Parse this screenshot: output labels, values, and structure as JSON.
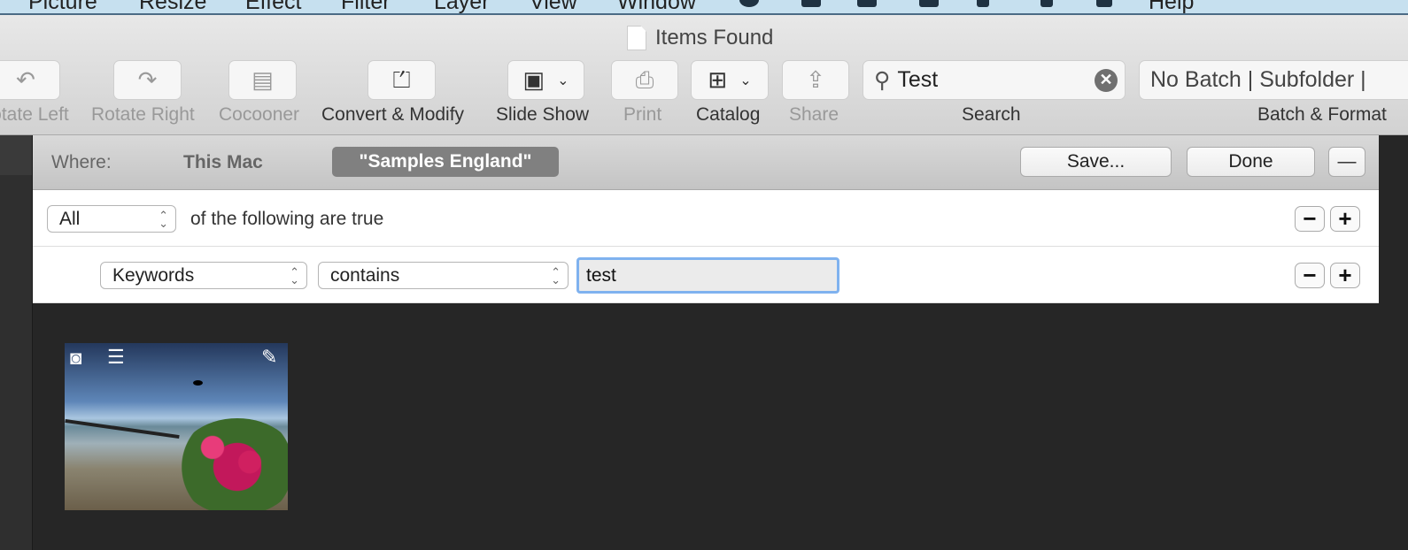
{
  "menu": [
    "Picture",
    "Resize",
    "Effect",
    "Filter",
    "Layer",
    "View",
    "Window",
    "Help"
  ],
  "window": {
    "title": "Items Found"
  },
  "toolbar": {
    "rotate_left": "Rotate Left",
    "rotate_right": "Rotate Right",
    "cocooner": "Cocooner",
    "convert": "Convert & Modify",
    "slideshow": "Slide Show",
    "print": "Print",
    "catalog": "Catalog",
    "share": "Share",
    "search_label": "Search",
    "search_value": "Test",
    "batch_value": "No Batch | Subfolder | ",
    "batch_label": "Batch & Format"
  },
  "where": {
    "label": "Where:",
    "this_mac": "This Mac",
    "scope": "\"Samples England\"",
    "save": "Save...",
    "done": "Done",
    "minus": "—"
  },
  "criteria": {
    "match": "All",
    "following": "of the following are true",
    "attribute": "Keywords",
    "operator": "contains",
    "value": "test",
    "minus": "−",
    "plus": "+"
  },
  "results": [
    {
      "icons": [
        "camera-icon",
        "text-lines-icon",
        "pin-icon"
      ]
    }
  ]
}
